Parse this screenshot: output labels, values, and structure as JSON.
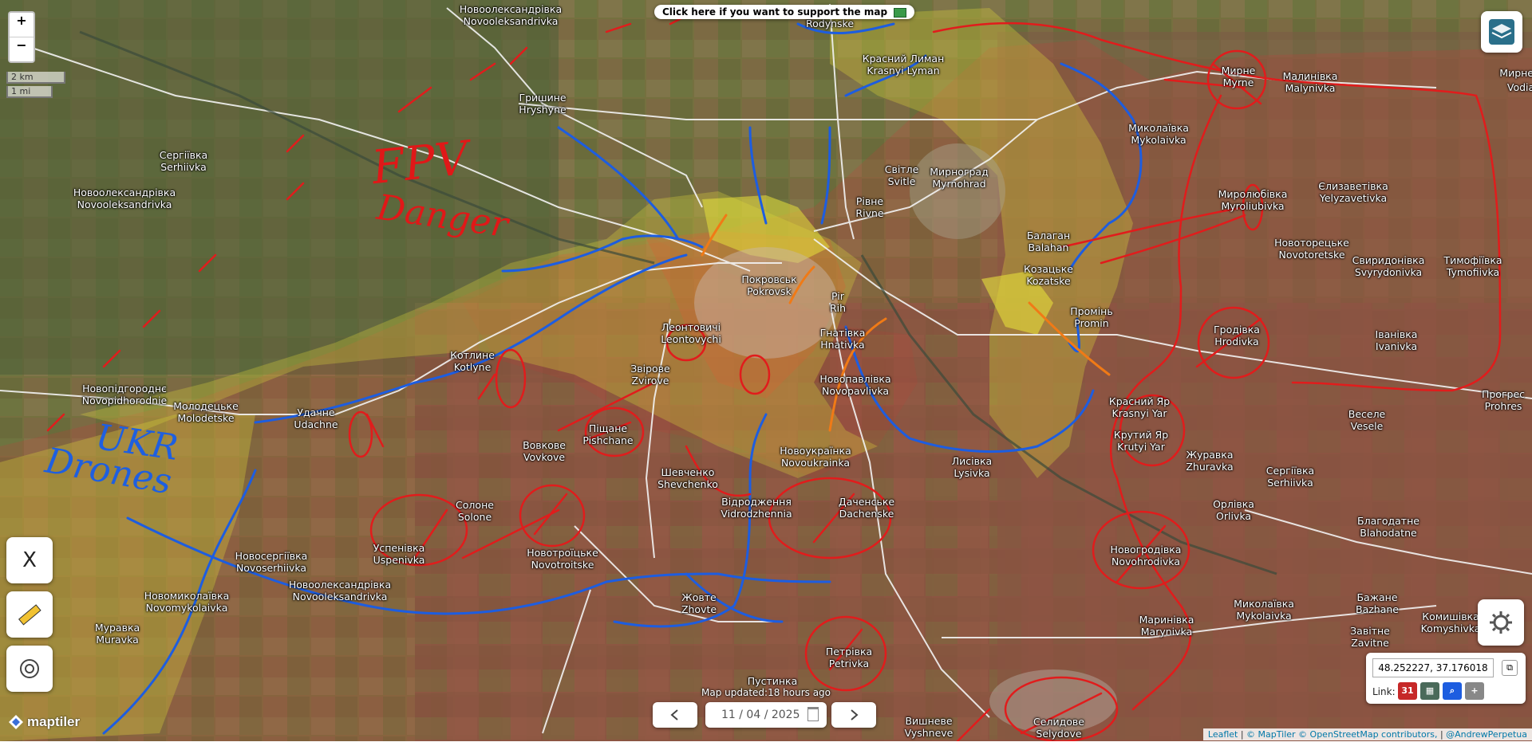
{
  "support_banner": "Click here if you want to support the map",
  "zoom": {
    "in": "+",
    "out": "−"
  },
  "scale": {
    "km": "2 km",
    "mi": "1 mi"
  },
  "update_note": "Map updated:18 hours ago",
  "date": "11 / 04 / 2025",
  "coordinates": "48.252227, 37.176018",
  "link_label": "Link:",
  "calendar_day": "31",
  "attribution": {
    "leaflet": "Leaflet",
    "maptiler": "© MapTiler",
    "osm": "© OpenStreetMap contributors,",
    "author": "@AndrewPerpetua"
  },
  "brand": "maptiler",
  "tools": {
    "close": "X",
    "ruler": "ruler-icon",
    "locate": "target-icon",
    "settings": "gear-icon",
    "layers": "layers-icon"
  },
  "annotations": {
    "fpv": "FPV",
    "danger": "Danger",
    "ukr": "UKR",
    "drones": "Drones"
  },
  "places": [
    {
      "uk": "Новоолександрівка",
      "en": "Novooleksandrivka"
    },
    {
      "uk": "",
      "en": "Rodynske"
    },
    {
      "uk": "Красний Лиман",
      "en": "Krasnyi Lyman"
    },
    {
      "uk": "Гришине",
      "en": "Hryshyne"
    },
    {
      "uk": "Сергіївка",
      "en": "Serhiivka"
    },
    {
      "uk": "Новоолександрівка",
      "en": "Novooleksandrivka"
    },
    {
      "uk": "Мирне",
      "en": "Myrne"
    },
    {
      "uk": "Малинівка",
      "en": "Malynivka"
    },
    {
      "uk": "",
      "en": "Vodian"
    },
    {
      "uk": "Миколаївка",
      "en": "Mykolaivka"
    },
    {
      "uk": "Світле",
      "en": "Svitle"
    },
    {
      "uk": "Мирноград",
      "en": "Myrnohrad"
    },
    {
      "uk": "Рівне",
      "en": "Rivne"
    },
    {
      "uk": "Миролюбівка",
      "en": "Myroliubivka"
    },
    {
      "uk": "Єлизаветівка",
      "en": "Yelyzavetivka"
    },
    {
      "uk": "Балаган",
      "en": "Balahan"
    },
    {
      "uk": "Новоторецьке",
      "en": "Novotoretske"
    },
    {
      "uk": "Свиридонівка",
      "en": "Svyrydonivka"
    },
    {
      "uk": "Тимофіївка",
      "en": "Tymofiivka"
    },
    {
      "uk": "Покровськ",
      "en": "Pokrovsk"
    },
    {
      "uk": "Козацьке",
      "en": "Kozatske"
    },
    {
      "uk": "Pir",
      "en": "Rih"
    },
    {
      "uk": "Промінь",
      "en": "Promin"
    },
    {
      "uk": "Леонтовичі",
      "en": "Leontovychi"
    },
    {
      "uk": "Гнатівка",
      "en": "Hnativka"
    },
    {
      "uk": "Гродівка",
      "en": "Hrodivka"
    },
    {
      "uk": "Іванівка",
      "en": "Ivanivka"
    },
    {
      "uk": "Котлине",
      "en": "Kotlyne"
    },
    {
      "uk": "Звірове",
      "en": "Zvirove"
    },
    {
      "uk": "Новопавлівка",
      "en": "Novopavlivka"
    },
    {
      "uk": "Новопідгороднє",
      "en": "Novopidhorodnie"
    },
    {
      "uk": "Молодецьке",
      "en": "Molodetske"
    },
    {
      "uk": "Удачне",
      "en": "Udachne"
    },
    {
      "uk": "Красний Яр",
      "en": "Krasnyi Yar"
    },
    {
      "uk": "Веселе",
      "en": "Vesele"
    },
    {
      "uk": "Прогрес",
      "en": "Prohres"
    },
    {
      "uk": "Піщане",
      "en": "Pishchane"
    },
    {
      "uk": "Вовкове",
      "en": "Vovkove"
    },
    {
      "uk": "Крутий Яр",
      "en": "Krutyi Yar"
    },
    {
      "uk": "Новоукраїнка",
      "en": "Novoukrainka"
    },
    {
      "uk": "Лисівка",
      "en": "Lysivka"
    },
    {
      "uk": "Журавка",
      "en": "Zhuravka"
    },
    {
      "uk": "Шевченко",
      "en": "Shevchenko"
    },
    {
      "uk": "Сергіївка",
      "en": "Serhiivka"
    },
    {
      "uk": "Відродження",
      "en": "Vidrodzhennia"
    },
    {
      "uk": "Даченське",
      "en": "Dachenske"
    },
    {
      "uk": "Орлівка",
      "en": "Orlivka"
    },
    {
      "uk": "Солоне",
      "en": "Solone"
    },
    {
      "uk": "Благодатне",
      "en": "Blahodatne"
    },
    {
      "uk": "Успенівка",
      "en": "Uspenivka"
    },
    {
      "uk": "Новотроїцьке",
      "en": "Novotroitske"
    },
    {
      "uk": "Новогродівка",
      "en": "Novohrodivka"
    },
    {
      "uk": "Новосергіївка",
      "en": "Novoserhiivka"
    },
    {
      "uk": "Новоолександрівка",
      "en": "Novooleksandrivka"
    },
    {
      "uk": "Новомиколаївка",
      "en": "Novomykolaivka"
    },
    {
      "uk": "Жовте",
      "en": "Zhovte"
    },
    {
      "uk": "Миколаївка",
      "en": "Mykolaivka"
    },
    {
      "uk": "Бажане",
      "en": "Bazhane"
    },
    {
      "uk": "Муравка",
      "en": "Muravka"
    },
    {
      "uk": "Маринівка",
      "en": "Marynivka"
    },
    {
      "uk": "Комишівка",
      "en": "Komyshivka"
    },
    {
      "uk": "Завітне",
      "en": "Zavitne"
    },
    {
      "uk": "Петрівка",
      "en": "Petrivka"
    },
    {
      "uk": "Пустинка",
      "en": "Pustynka"
    },
    {
      "uk": "Вишневе",
      "en": "Vyshneve"
    },
    {
      "uk": "Селидове",
      "en": "Selydove"
    },
    {
      "uk": "Мирне",
      "en": "Myrne"
    }
  ]
}
